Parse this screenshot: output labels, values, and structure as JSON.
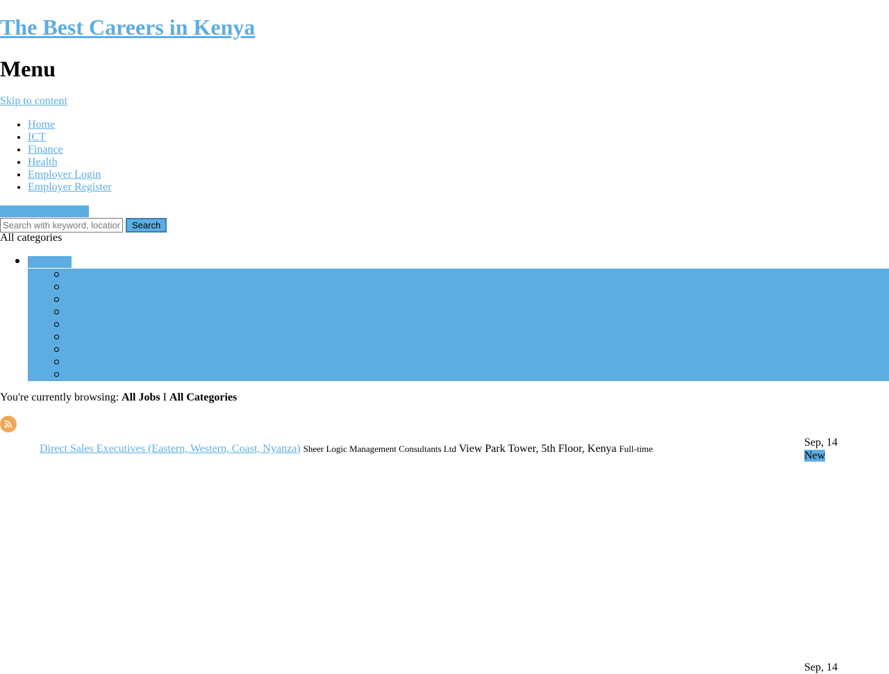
{
  "site": {
    "title": "The Best Careers in Kenya",
    "menu_title": "Menu",
    "skip_link": "Skip to content"
  },
  "nav": {
    "items": [
      {
        "label": "Home"
      },
      {
        "label": "ICT"
      },
      {
        "label": "Finance"
      },
      {
        "label": "Health"
      },
      {
        "label": "Employer Login"
      },
      {
        "label": "Employer Register"
      }
    ]
  },
  "search": {
    "placeholder": "Search with keyword, location",
    "button_label": "Search",
    "category_select": "All categories"
  },
  "browsing": {
    "prefix": "You're currently browsing: ",
    "jobs": "All Jobs",
    "separator": " I ",
    "categories": "All Categories"
  },
  "jobs": [
    {
      "title": "Direct Sales Executives (Eastern, Western, Coast, Nyanza)",
      "company": "Sheer Logic Management Consultants Ltd",
      "location": "View Park Tower, 5th Floor, Kenya",
      "type": "Full-time",
      "date": "Sep, 14",
      "badge": "New"
    },
    {
      "date": "Sep, 14"
    }
  ],
  "colors": {
    "accent": "#5dade2",
    "rss": "#f0a85a"
  },
  "icons": {
    "rss": "rss-feed-icon"
  }
}
